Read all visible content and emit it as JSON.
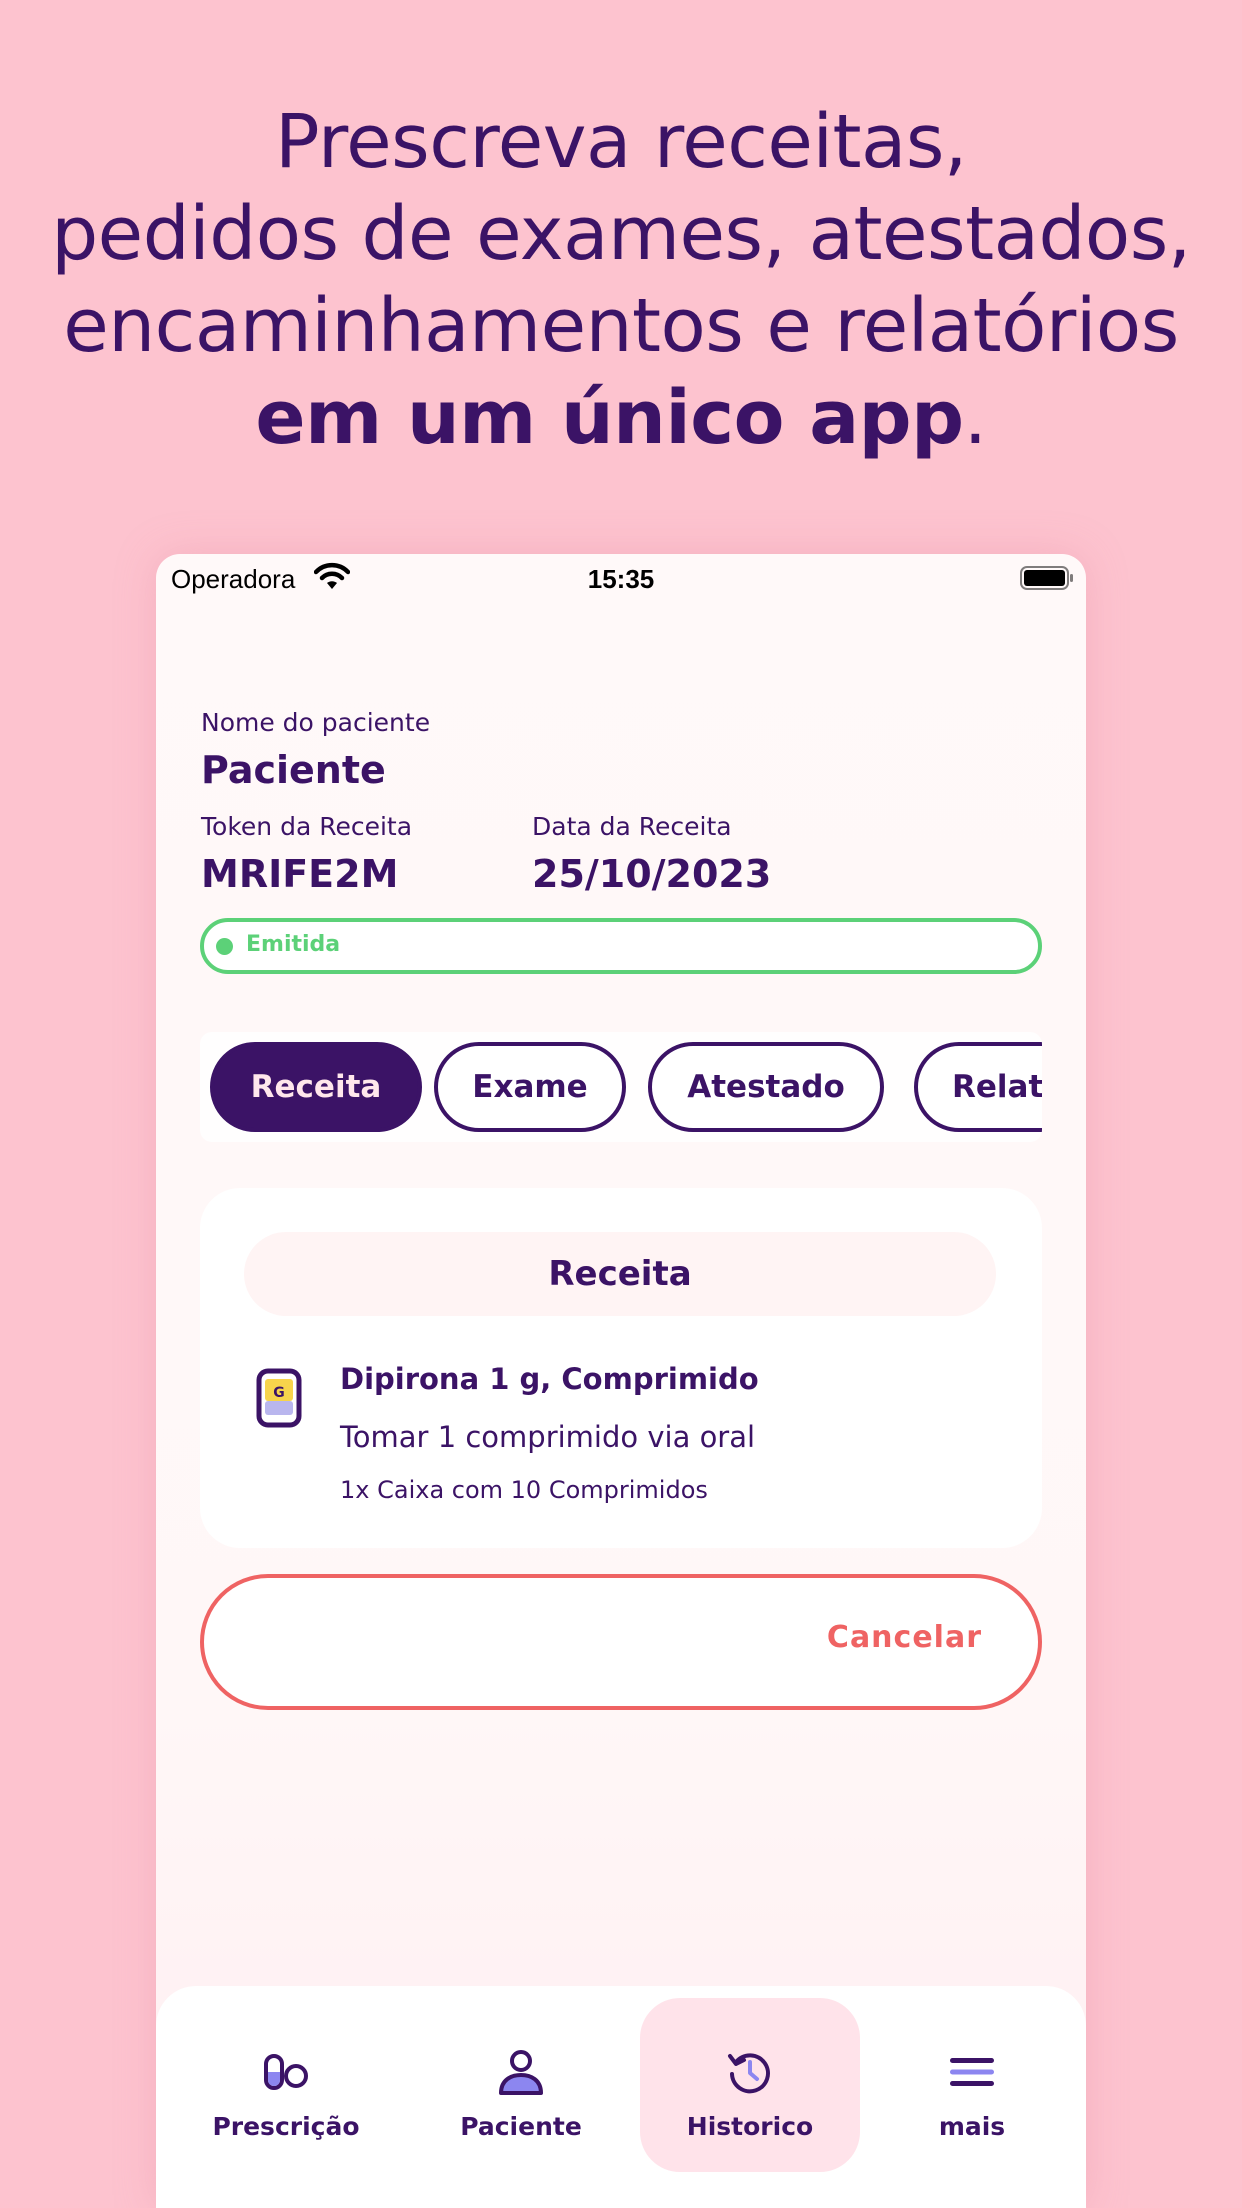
{
  "headline": {
    "line1": "Prescreva receitas,",
    "line2": "pedidos de exames, atestados,",
    "line3": "encaminhamentos e relatórios",
    "line4_bold": "em um único app",
    "line4_end": "."
  },
  "status_bar": {
    "carrier": "Operadora",
    "time": "15:35",
    "icons": [
      "wifi-icon",
      "battery-icon"
    ]
  },
  "patient": {
    "name_label": "Nome do paciente",
    "name_value": "Paciente",
    "token_label": "Token da Receita",
    "token_value": "MRIFE2M",
    "date_label": "Data da Receita",
    "date_value": "25/10/2023",
    "status": "Emitida"
  },
  "tabs": [
    {
      "label": "Receita",
      "active": true
    },
    {
      "label": "Exame",
      "active": false
    },
    {
      "label": "Atestado",
      "active": false
    },
    {
      "label": "Relat",
      "active": false
    }
  ],
  "card": {
    "title": "Receita",
    "item": {
      "icon": "medicine-icon",
      "icon_letter": "G",
      "name": "Dipirona 1 g, Comprimido",
      "instructions": "Tomar 1 comprimido via oral",
      "quantity": "1x Caixa com 10 Comprimidos"
    }
  },
  "actions": {
    "cancel_label": "Cancelar"
  },
  "bottom_nav": [
    {
      "label": "Prescrição",
      "icon": "pills-icon",
      "active": false
    },
    {
      "label": "Paciente",
      "icon": "person-icon",
      "active": false
    },
    {
      "label": "Historico",
      "icon": "history-icon",
      "active": true
    },
    {
      "label": "mais",
      "icon": "menu-icon",
      "active": false
    }
  ],
  "colors": {
    "background": "#fdc3cf",
    "primary": "#3b1366",
    "success": "#5cd178",
    "danger": "#ef6363",
    "nav_active": "#ffe3ea"
  }
}
